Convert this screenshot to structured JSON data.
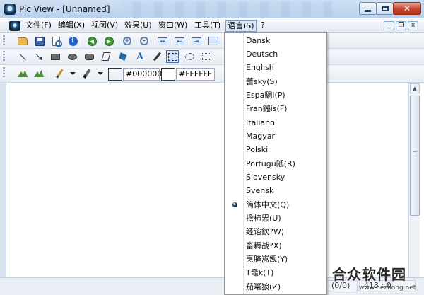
{
  "window": {
    "title": "Pic View - [Unnamed]",
    "minimize_label": "–",
    "maximize_label": "□",
    "close_label": "✕"
  },
  "menubar": {
    "items": [
      {
        "label": "文件(F)"
      },
      {
        "label": "编辑(X)"
      },
      {
        "label": "视图(V)"
      },
      {
        "label": "效果(U)"
      },
      {
        "label": "窗口(W)"
      },
      {
        "label": "工具(T)"
      },
      {
        "label": "语言(S)"
      },
      {
        "label": "?"
      }
    ],
    "mdi": {
      "minimize": "_",
      "restore": "❐",
      "close": "x"
    }
  },
  "toolbar": {
    "foreground_color": "#000000",
    "background_color": "#FFFFFF",
    "fg_swatch": "#000000",
    "bg_swatch": "#FFFFFF"
  },
  "language_menu": {
    "selected": "简体中文(Q)",
    "items": [
      "Dansk",
      "Deutsch",
      "English",
      "蓍sky(S)",
      "Espa駉l(P)",
      "Fran鏰is(F)",
      "Italiano",
      "Magyar",
      "Polski",
      "Portugu阺(R)",
      "Slovensky",
      "Svensk",
      "简体中文(Q)",
      "擔柿惥(U)",
      "经谘欽?W)",
      "畜耨战?X)",
      "烹腌嵩觊(Y)",
      "T鼀k(T)",
      "茄鼍狼(Z)"
    ]
  },
  "statusbar": {
    "page": "(0/0)",
    "ratio": "413 : 0"
  },
  "watermark": {
    "title": "合众软件园",
    "url": "www.hezhong.net"
  }
}
